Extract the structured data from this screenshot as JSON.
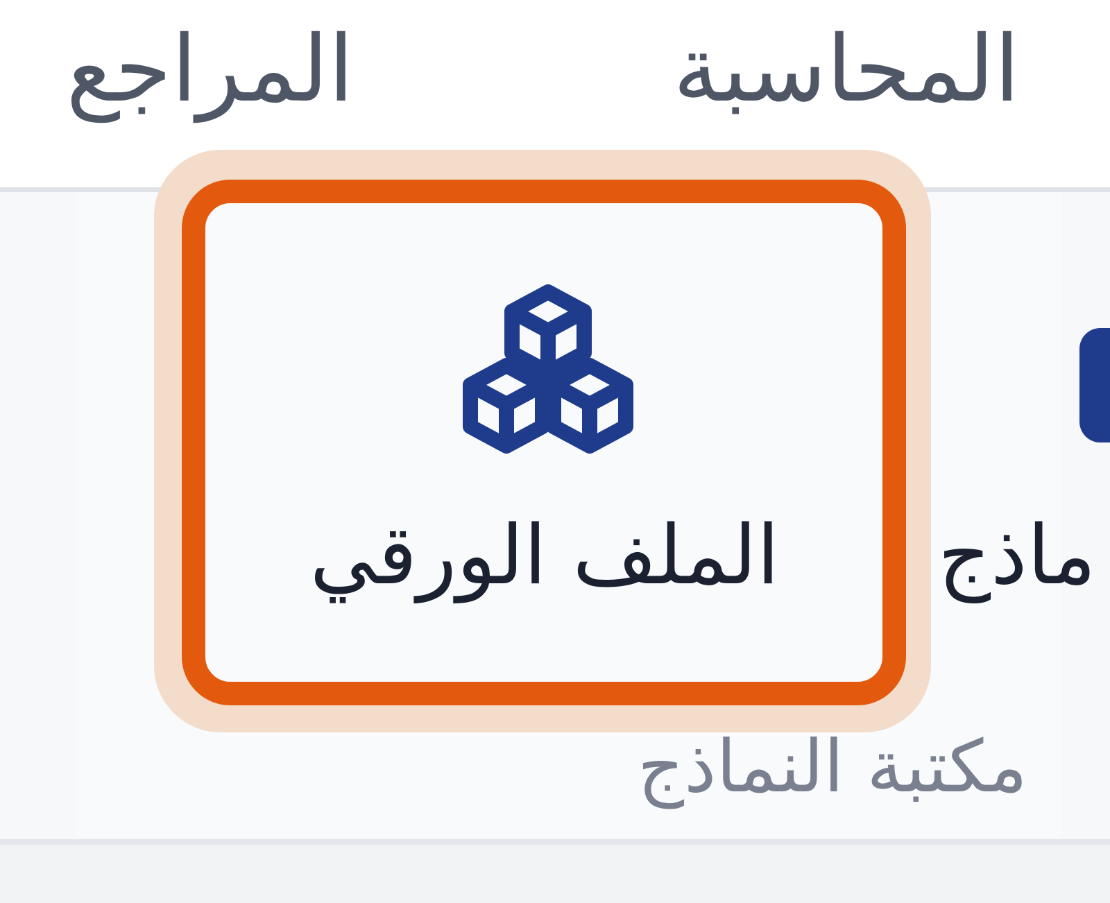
{
  "tabs": {
    "accounting": "المحاسبة",
    "references": "المراجع"
  },
  "ribbon": {
    "paper_file_button": {
      "label": "الملف الورقي",
      "icon": "cubes-icon",
      "selected": true
    },
    "next_button": {
      "label_fragment": "ماذج"
    },
    "group_caption": "مكتبة النماذج"
  },
  "colors": {
    "icon": "#1f3c8c",
    "focus_border": "#e35a0f",
    "focus_glow": "#f4dccb",
    "tab_text": "#4f5666",
    "caption_text": "#7a8090"
  }
}
